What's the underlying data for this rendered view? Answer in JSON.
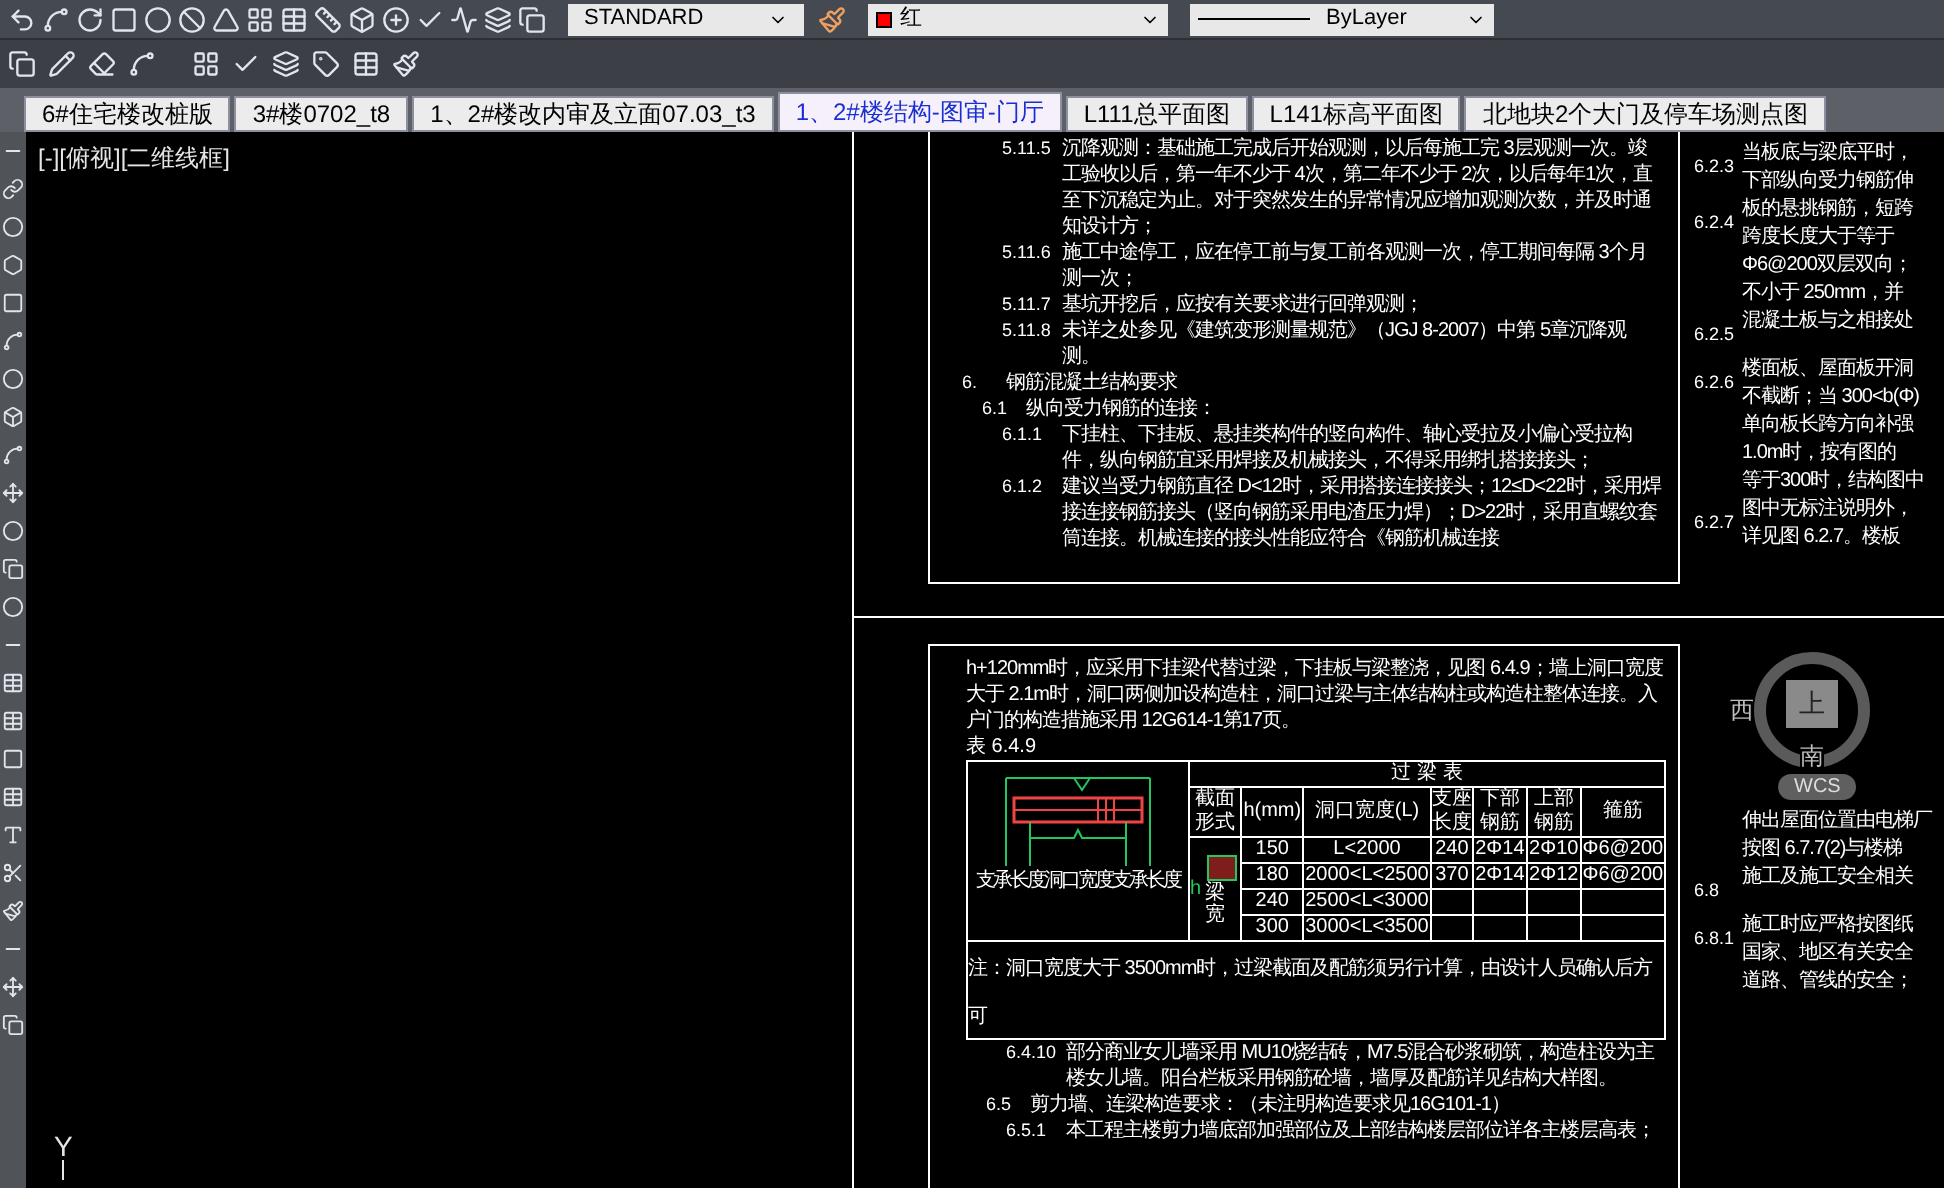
{
  "toolbar": {
    "text_style": "STANDARD",
    "color_name": "红",
    "linetype": "ByLayer"
  },
  "tabs": [
    {
      "label": "6#住宅楼改桩版",
      "selected": false
    },
    {
      "label": "3#楼0702_t8",
      "selected": false
    },
    {
      "label": "1、2#楼改内审及立面07.03_t3",
      "selected": false
    },
    {
      "label": "1、2#楼结构-图审-门厅",
      "selected": true
    },
    {
      "label": "L111总平面图",
      "selected": false
    },
    {
      "label": "L141标高平面图",
      "selected": false
    },
    {
      "label": "北地块2个大门及停车场测点图",
      "selected": false
    }
  ],
  "viewport_label": "[-][俯视][二维线框]",
  "top_sheet": {
    "clauses": [
      {
        "kind": "clause",
        "number": "5.11.5",
        "text": "沉降观测：基础施工完成后开始观测，以后每施工完 3层观测一次。竣工验收以后，第一年不少于 4次，第二年不少于 2次，以后每年1次，直至下沉稳定为止。对于突然发生的异常情况应增加观测次数，并及时通知设计方；"
      },
      {
        "kind": "clause",
        "number": "5.11.6",
        "text": "施工中途停工，应在停工前与复工前各观测一次，停工期间每隔 3个月测一次；"
      },
      {
        "kind": "clause",
        "number": "5.11.7",
        "text": "基坑开挖后，应按有关要求进行回弹观测；"
      },
      {
        "kind": "clause",
        "number": "5.11.8",
        "text": "未详之处参见《建筑变形测量规范》（JGJ 8-2007）中第 5章沉降观测。"
      },
      {
        "kind": "section",
        "number": "6.",
        "text": "钢筋混凝土结构要求"
      },
      {
        "kind": "subsection",
        "number": "6.1",
        "text": "纵向受力钢筋的连接："
      },
      {
        "kind": "clause",
        "number": "6.1.1",
        "text": "下挂柱、下挂板、悬挂类构件的竖向构件、轴心受拉及小偏心受拉构件，纵向钢筋宜采用焊接及机械接头，不得采用绑扎搭接接头；"
      },
      {
        "kind": "clause",
        "number": "6.1.2",
        "text": "建议当受力钢筋直径 D<12时，采用搭接连接接头；12≤D<22时，采用焊接连接钢筋接头（竖向钢筋采用电渣压力焊）；D>22时，采用直螺纹套筒连接。机械连接的接头性能应符合《钢筋机械连接"
      }
    ]
  },
  "top_right_column": {
    "clauses": [
      {
        "number": "6.2.3",
        "lines": [
          "当板底与梁底平时，",
          "下部纵向受力钢筋伸"
        ]
      },
      {
        "number": "6.2.4",
        "lines": [
          "板的悬挑钢筋，短跨",
          "跨度长度大于等于",
          "Φ6@200双层双向；",
          "不小于 250mm，并"
        ]
      },
      {
        "number": "6.2.5",
        "lines": [
          "混凝土板与之相接处"
        ]
      },
      {
        "number": "6.2.6",
        "lines": [
          "楼面板、屋面板开洞",
          "不截断；当 300<b(Φ)",
          "单向板长跨方向补强",
          "1.0m时，按有图的",
          "等于300时，结构图中"
        ]
      },
      {
        "number": "6.2.7",
        "lines": [
          "图中无标注说明外，",
          "详见图 6.2.7。楼板"
        ]
      }
    ]
  },
  "bottom_sheet": {
    "intro": "h+120mm时，应采用下挂梁代替过梁，下挂板与梁整浇，见图 6.4.9；墙上洞口宽度大于 2.1m时，洞口两侧加设构造柱，洞口过梁与主体结构柱或构造柱整体连接。入户门的构造措施采用 12G614-1第17页。",
    "table_caption": "表 6.4.9",
    "lintel_table": {
      "title": "过 梁 表",
      "columns": [
        "截面形式",
        "h(mm)",
        "洞口宽度(L)",
        "支座长度",
        "下部钢筋",
        "上部钢筋",
        "箍筋"
      ],
      "rows": [
        [
          "",
          "150",
          "L<2000",
          "240",
          "2Φ14",
          "2Φ10",
          "Φ6@200"
        ],
        [
          "",
          "180",
          "2000<L<2500",
          "370",
          "2Φ14",
          "2Φ12",
          "Φ6@200"
        ],
        [
          "",
          "240",
          "2500<L<3000"
        ],
        [
          "",
          "300",
          "3000<L<3500"
        ]
      ],
      "section_label": "梁宽",
      "height_label": "h",
      "diagram_labels": [
        "支承长度",
        "洞口宽度",
        "支承长度"
      ],
      "note": "注：洞口宽度大于 3500mm时，过梁截面及配筋须另行计算，由设计人员确认后方可"
    },
    "clauses": [
      {
        "kind": "clause",
        "number": "6.4.10",
        "text": "部分商业女儿墙采用 MU10烧结砖，M7.5混合砂浆砌筑，构造柱设为主楼女儿墙。阳台栏板采用钢筋砼墙，墙厚及配筋详见结构大样图。"
      },
      {
        "kind": "subsection",
        "number": "6.5",
        "text": "剪力墙、连梁构造要求：（未注明构造要求见16G101-1）"
      },
      {
        "kind": "clause",
        "number": "6.5.1",
        "text": "本工程主楼剪力墙底部加强部位及上部结构楼层部位详各主楼层高表；"
      }
    ]
  },
  "bottom_right_column": {
    "clauses": [
      {
        "lines": [
          "伸出屋面位置由电梯厂",
          "按图 6.7.7(2)与楼梯"
        ]
      },
      {
        "number": "6.8",
        "lines": [
          "施工及施工安全相关"
        ]
      },
      {
        "number": "6.8.1",
        "lines": [
          "施工时应严格按图纸",
          "国家、地区有关安全",
          "道路、管线的安全；"
        ]
      }
    ]
  },
  "view_cube": {
    "top": "上",
    "west": "西",
    "south": "南",
    "badge": "WCS"
  },
  "ucs_axis": "Y"
}
